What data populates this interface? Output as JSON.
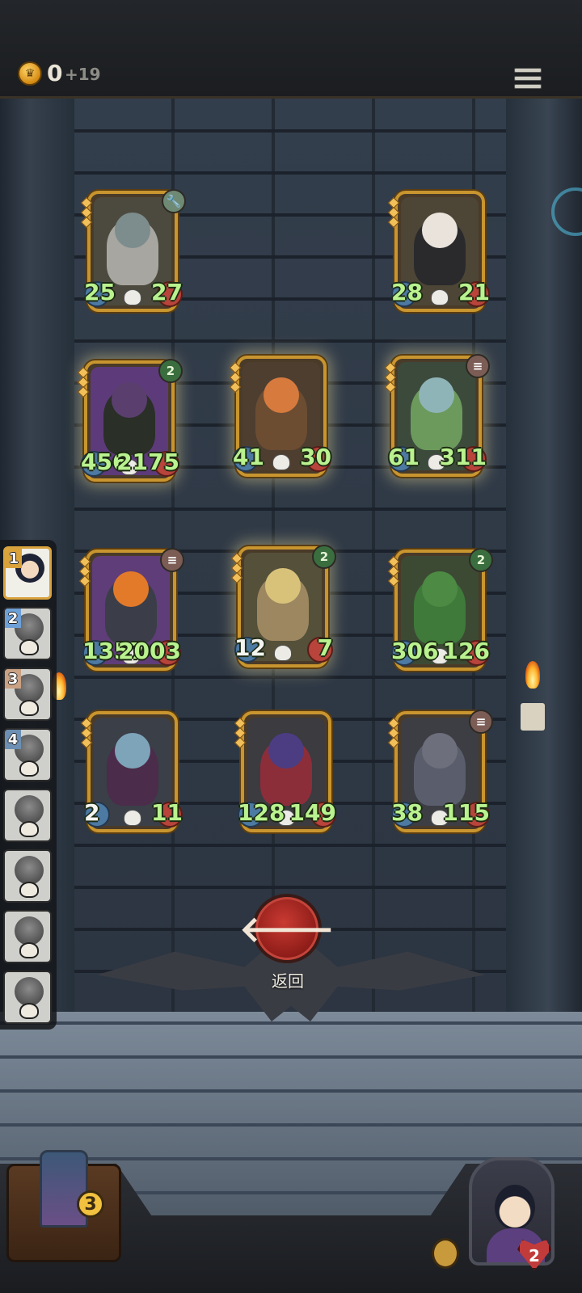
{
  "topbar": {
    "coin_count": "0",
    "coin_income": "+19"
  },
  "cards": [
    {
      "atk": "25",
      "hp": "27",
      "badge": "wrench",
      "atk_white": false,
      "colors": {
        "bg": "#4c4a3e",
        "fig": "#a7a6a0",
        "head": "#7d8c8c"
      }
    },
    {
      "atk": "28",
      "hp": "21",
      "badge": "",
      "atk_white": false,
      "colors": {
        "bg": "#4d4536",
        "fig": "#2a2a2c",
        "head": "#e9e3dc"
      }
    },
    {
      "atk": "456",
      "hp": "2175",
      "badge": "2",
      "atk_white": false,
      "colors": {
        "bg": "#5d3a7a",
        "fig": "#2a2f27",
        "head": "#5a3f6e"
      }
    },
    {
      "atk": "41",
      "hp": "30",
      "badge": "",
      "atk_white": false,
      "colors": {
        "bg": "#4e3e30",
        "fig": "#6c4d32",
        "head": "#d77a3e"
      }
    },
    {
      "atk": "61",
      "hp": "311",
      "badge": "beast",
      "atk_white": false,
      "colors": {
        "bg": "#3c4a3c",
        "fig": "#6c9a5c",
        "head": "#8fb4b8"
      }
    },
    {
      "atk": "1357",
      "hp": "2003",
      "badge": "beast",
      "atk_white": false,
      "colors": {
        "bg": "#5f3d78",
        "fig": "#3b3e48",
        "head": "#e37a2a"
      }
    },
    {
      "atk": "12",
      "hp": "7",
      "badge": "2",
      "atk_white": true,
      "colors": {
        "bg": "#54503a",
        "fig": "#9d8760",
        "head": "#d8c27a"
      }
    },
    {
      "atk": "306",
      "hp": "126",
      "badge": "2",
      "atk_white": false,
      "colors": {
        "bg": "#3c4a34",
        "fig": "#3f7a3a",
        "head": "#4d8a44"
      }
    },
    {
      "atk": "2",
      "hp": "11",
      "badge": "",
      "atk_white": true,
      "colors": {
        "bg": "#3b3f48",
        "fig": "#4b2c4a",
        "head": "#7ea4ba"
      }
    },
    {
      "atk": "128",
      "hp": "149",
      "badge": "",
      "atk_white": false,
      "colors": {
        "bg": "#3b3b40",
        "fig": "#8c2e3a",
        "head": "#4c3d82"
      }
    },
    {
      "atk": "38",
      "hp": "115",
      "badge": "beast",
      "atk_white": false,
      "colors": {
        "bg": "#3d3e44",
        "fig": "#5a5e6c",
        "head": "#6e6f7c"
      }
    }
  ],
  "sidebar": {
    "items": [
      {
        "rank": "1",
        "rank_style": "gold",
        "active": true
      },
      {
        "rank": "2",
        "rank_style": "blue",
        "active": false
      },
      {
        "rank": "3",
        "rank_style": "tan",
        "active": false
      },
      {
        "rank": "4",
        "rank_style": "steel",
        "active": false
      },
      {
        "rank": "",
        "rank_style": "",
        "active": false
      },
      {
        "rank": "",
        "rank_style": "",
        "active": false
      },
      {
        "rank": "",
        "rank_style": "",
        "active": false
      },
      {
        "rank": "",
        "rank_style": "",
        "active": false
      }
    ]
  },
  "return": {
    "icon": "arrow-left-icon",
    "label": "返回"
  },
  "deck": {
    "count": "3"
  },
  "hero": {
    "life": "2"
  }
}
